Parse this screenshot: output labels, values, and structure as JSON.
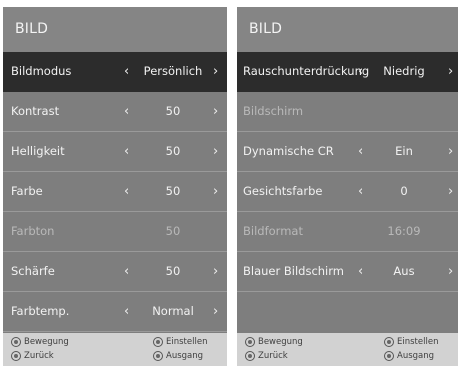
{
  "left_screen": {
    "title": "BILD",
    "rows": [
      {
        "label": "Bildmodus",
        "value": "Persönlich",
        "left_arrow": "‹",
        "right_arrow": "›"
      },
      {
        "label": "Kontrast",
        "value": "50",
        "left_arrow": "‹",
        "right_arrow": "›"
      },
      {
        "label": "Helligkeit",
        "value": "50",
        "left_arrow": "‹",
        "right_arrow": "›"
      },
      {
        "label": "Farbe",
        "value": "50",
        "left_arrow": "‹",
        "right_arrow": "›"
      },
      {
        "label": "Farbton",
        "value": "50"
      },
      {
        "label": "Schärfe",
        "value": "50",
        "left_arrow": "‹",
        "right_arrow": "›"
      },
      {
        "label": "Farbtemp.",
        "value": "Normal",
        "left_arrow": "‹",
        "right_arrow": "›"
      }
    ],
    "footer": {
      "move": "Bewegung",
      "back": "Zurück",
      "adjust": "Einstellen",
      "exit": "Ausgang"
    }
  },
  "right_screen": {
    "title": "BILD",
    "rows": [
      {
        "label": "Rauschunterdrückung",
        "value": "Niedrig",
        "left_arrow": "‹",
        "right_arrow": "›"
      },
      {
        "label": "Bildschirm"
      },
      {
        "label": "Dynamische CR",
        "value": "Ein",
        "left_arrow": "‹",
        "right_arrow": "›"
      },
      {
        "label": "Gesichtsfarbe",
        "value": "0",
        "left_arrow": "‹",
        "right_arrow": "›"
      },
      {
        "label": "Bildformat",
        "value": "16:09"
      },
      {
        "label": "Blauer Bildschirm",
        "value": "Aus",
        "left_arrow": "‹",
        "right_arrow": "›"
      }
    ],
    "footer": {
      "move": "Bewegung",
      "back": "Zurück",
      "adjust": "Einstellen",
      "exit": "Ausgang"
    }
  },
  "colors": {
    "panel_bg": "#7e7e7e",
    "title_bg": "#858585",
    "selected_row_bg": "#2c2c2c",
    "footer_bg": "#d2d2d2",
    "text": "#f2f2f2",
    "disabled_text": "#b9b9b9"
  }
}
